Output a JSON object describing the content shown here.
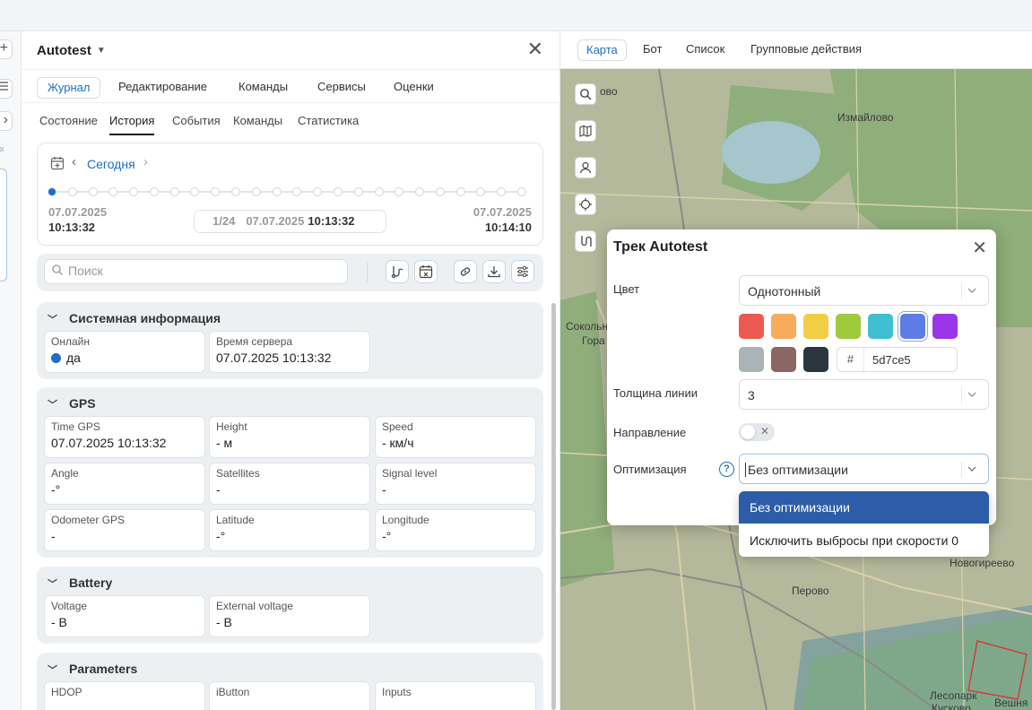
{
  "panel": {
    "title": "Autotest",
    "tabs": [
      "Журнал",
      "Редактирование",
      "Команды",
      "Сервисы",
      "Оценки"
    ],
    "subtabs": [
      "Состояние",
      "История",
      "События",
      "Команды",
      "Статистика"
    ]
  },
  "timeline": {
    "date_label": "Сегодня",
    "start_date": "07.07.2025",
    "start_time": "10:13:32",
    "end_date": "07.07.2025",
    "end_time": "10:14:10",
    "position": "1/24",
    "current_date": "07.07.2025",
    "current_time": "10:13:32",
    "active_point": 1,
    "points_total": 24
  },
  "search": {
    "placeholder": "Поиск"
  },
  "sections": {
    "system": {
      "title": "Системная информация",
      "online_label": "Онлайн",
      "online_value": "да",
      "server_time_label": "Время сервера",
      "server_time_value": "07.07.2025 10:13:32"
    },
    "gps": {
      "title": "GPS",
      "fields": [
        {
          "label": "Time GPS",
          "value": "07.07.2025 10:13:32"
        },
        {
          "label": "Height",
          "value": "- м"
        },
        {
          "label": "Speed",
          "value": "- км/ч"
        },
        {
          "label": "Angle",
          "value": "-°"
        },
        {
          "label": "Satellites",
          "value": "-"
        },
        {
          "label": "Signal level",
          "value": "-"
        },
        {
          "label": "Odometer GPS",
          "value": "-"
        },
        {
          "label": "Latitude",
          "value": "-°"
        },
        {
          "label": "Longitude",
          "value": "-°"
        }
      ]
    },
    "battery": {
      "title": "Battery",
      "fields": [
        {
          "label": "Voltage",
          "value": "- В"
        },
        {
          "label": "External voltage",
          "value": "- В"
        }
      ]
    },
    "parameters": {
      "title": "Parameters",
      "fields": [
        {
          "label": "HDOP"
        },
        {
          "label": "iButton"
        },
        {
          "label": "Inputs"
        }
      ]
    }
  },
  "map": {
    "tabs": [
      "Карта",
      "Бот",
      "Список",
      "Групповые действия"
    ],
    "labels": {
      "izmaylovo": "Измайлово",
      "novogireevo": "Новогиреево",
      "perovo": "Перово",
      "sokolniki": "Сокольни",
      "gora": "Гора",
      "top_left": "ово",
      "lesopark": "Лесопарк",
      "kuskovo": "Кусково",
      "veshnya": "Вешня"
    }
  },
  "dialog": {
    "title": "Трек Autotest",
    "color_label": "Цвет",
    "color_mode": "Однотонный",
    "swatches": [
      "#eb5a50",
      "#f6ab5d",
      "#f2cd45",
      "#9dcb3c",
      "#3fbfd1",
      "#5d7ce5",
      "#9b35e8",
      "#aab4b6",
      "#8b6662",
      "#2c3641"
    ],
    "selected_swatch": 5,
    "hash": "#",
    "hex_value": "5d7ce5",
    "line_width_label": "Толщина линии",
    "line_width_value": "3",
    "direction_label": "Направление",
    "direction_enabled": false,
    "optimization_label": "Оптимизация",
    "optimization_value": "Без оптимизации",
    "optimization_options": [
      "Без оптимизации",
      "Исключить выбросы при скорости 0"
    ]
  },
  "colors": {
    "accent": "#1f6dc6",
    "dropdown_active": "#2d5ca8"
  }
}
